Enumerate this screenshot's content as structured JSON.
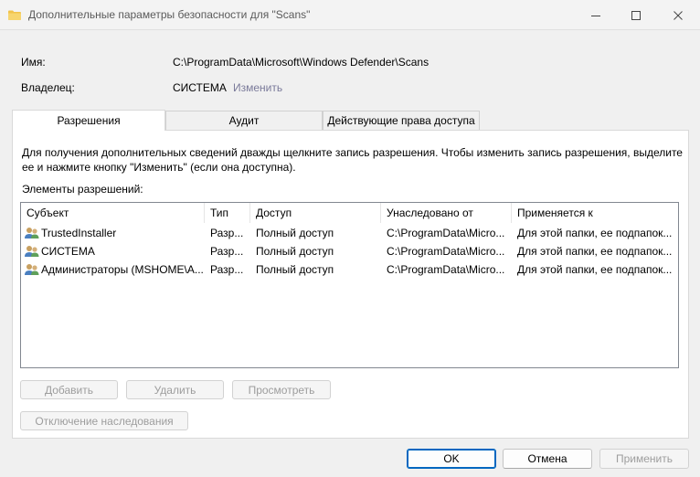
{
  "window": {
    "title": "Дополнительные параметры безопасности  для \"Scans\""
  },
  "info": {
    "name_label": "Имя:",
    "name_value": "C:\\ProgramData\\Microsoft\\Windows Defender\\Scans",
    "owner_label": "Владелец:",
    "owner_value": "СИСТЕМА",
    "change_link": "Изменить"
  },
  "tabs": [
    {
      "label": "Разрешения",
      "active": true
    },
    {
      "label": "Аудит",
      "active": false
    },
    {
      "label": "Действующие права доступа",
      "active": false
    }
  ],
  "permissions": {
    "description": "Для получения дополнительных сведений дважды щелкните запись разрешения. Чтобы изменить запись разрешения, выделите ее и нажмите кнопку \"Изменить\" (если она доступна).",
    "elements_label": "Элементы разрешений:",
    "columns": [
      "Субъект",
      "Тип",
      "Доступ",
      "Унаследовано от",
      "Применяется к"
    ],
    "rows": [
      [
        "TrustedInstaller",
        "Разр...",
        "Полный доступ",
        "C:\\ProgramData\\Micro...",
        "Для этой папки, ее подпапок..."
      ],
      [
        "СИСТЕМА",
        "Разр...",
        "Полный доступ",
        "C:\\ProgramData\\Micro...",
        "Для этой папки, ее подпапок..."
      ],
      [
        "Администраторы (MSHOME\\А...",
        "Разр...",
        "Полный доступ",
        "C:\\ProgramData\\Micro...",
        "Для этой папки, ее подпапок..."
      ]
    ],
    "buttons": {
      "add": "Добавить",
      "remove": "Удалить",
      "view": "Просмотреть",
      "disable_inheritance": "Отключение наследования"
    }
  },
  "footer": {
    "ok": "OK",
    "cancel": "Отмена",
    "apply": "Применить"
  },
  "colors": {
    "accent": "#0067c0",
    "folder": "#f2c34b"
  }
}
